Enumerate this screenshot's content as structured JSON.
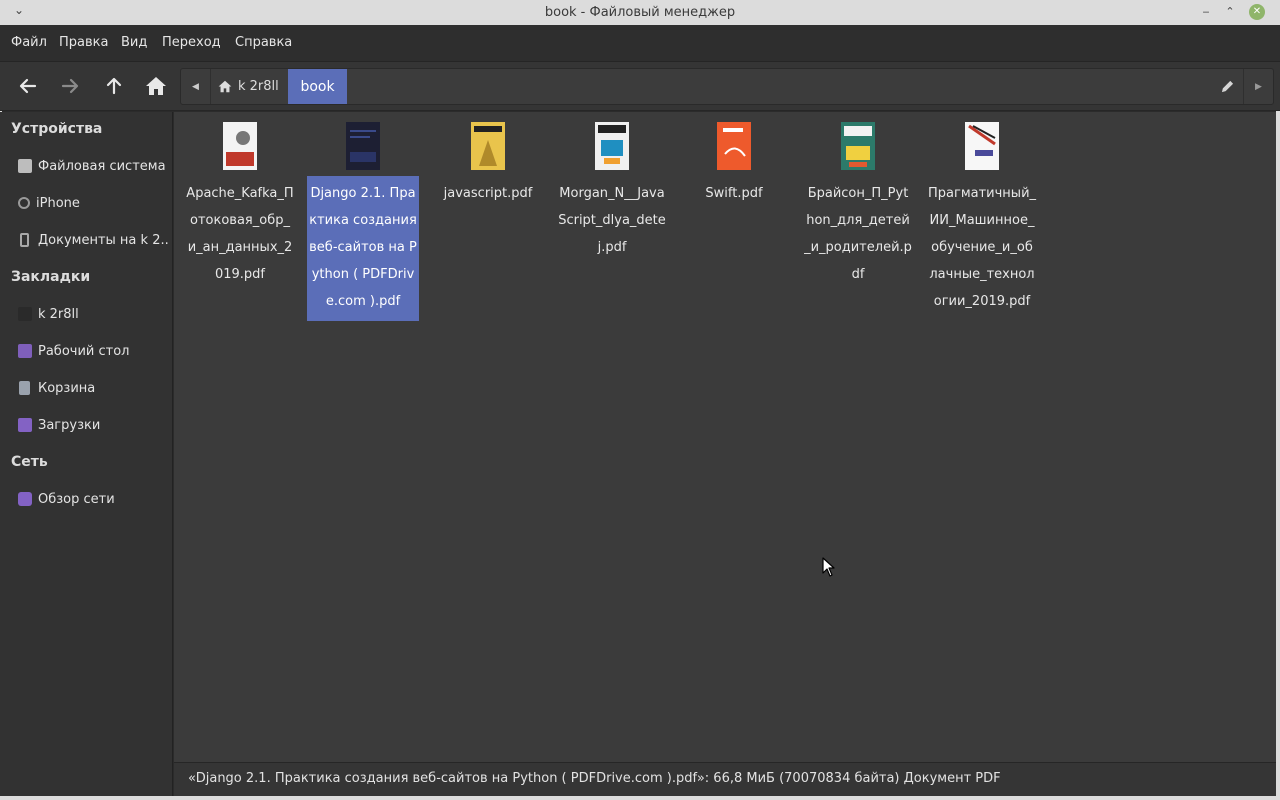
{
  "window": {
    "title": "book - Файловый менеджер",
    "menu_glyph": "⌄",
    "min_glyph": "‒",
    "max_glyph": "⌃",
    "close_glyph": "✕"
  },
  "menu": [
    "Файл",
    "Правка",
    "Вид",
    "Переход",
    "Справка"
  ],
  "toolbar": {
    "back_icon": "arrow-left-icon",
    "forward_icon": "arrow-right-icon",
    "up_icon": "arrow-up-icon",
    "home_icon": "home-icon",
    "path_left_glyph": "◀",
    "path_right_glyph": "▶"
  },
  "pathbar": {
    "home_label": "k 2r8ll",
    "current_label": "book"
  },
  "sidebar": {
    "devices_header": "Устройства",
    "devices": [
      {
        "label": "Файловая система",
        "icon": "drive-icon"
      },
      {
        "label": "iPhone",
        "icon": "phone-icon"
      },
      {
        "label": "Документы на k 2...",
        "icon": "phone-device-icon"
      }
    ],
    "bookmarks_header": "Закладки",
    "bookmarks": [
      {
        "label": "k 2r8ll",
        "icon": "home-folder-icon"
      },
      {
        "label": "Рабочий стол",
        "icon": "folder-icon"
      },
      {
        "label": "Корзина",
        "icon": "trash-icon"
      },
      {
        "label": "Загрузки",
        "icon": "download-folder-icon"
      }
    ],
    "network_header": "Сеть",
    "network": [
      {
        "label": "Обзор сети",
        "icon": "network-icon"
      }
    ]
  },
  "files": [
    {
      "name": "Apache_Kafka_Потоковая_обр_и_ан_данных_2019.pdf",
      "color": "#f4f4f4",
      "accent": "#c0392b"
    },
    {
      "name": "Django 2.1. Практика создания веб-сайтов на Python ( PDFDrive.com ).pdf",
      "color": "#1d1f33",
      "accent": "#3a4a8a",
      "selected": true
    },
    {
      "name": "javascript.pdf",
      "color": "#e9c44c",
      "accent": "#222"
    },
    {
      "name": "Morgan_N__JavaScript_dlya_detej.pdf",
      "color": "#f0f0f0",
      "accent": "#1f8fc1"
    },
    {
      "name": "Swift.pdf",
      "color": "#ee5a2c",
      "accent": "#fff"
    },
    {
      "name": "Брайсон_П_Python_для_детей_и_родителей.pdf",
      "color": "#2c7a6a",
      "accent": "#f0d040"
    },
    {
      "name": "Прагматичный_ИИ_Машинное_обучение_и_облачные_технологии_2019.pdf",
      "color": "#f7f7f7",
      "accent": "#c0392b"
    }
  ],
  "status": "«Django 2.1. Практика создания веб-сайтов на Python ( PDFDrive.com ).pdf»: 66,8 МиБ (70070834 байта) Документ PDF",
  "colors": {
    "selection": "#5b6eb8",
    "background": "#3b3b3b",
    "sidebar": "#323232"
  }
}
